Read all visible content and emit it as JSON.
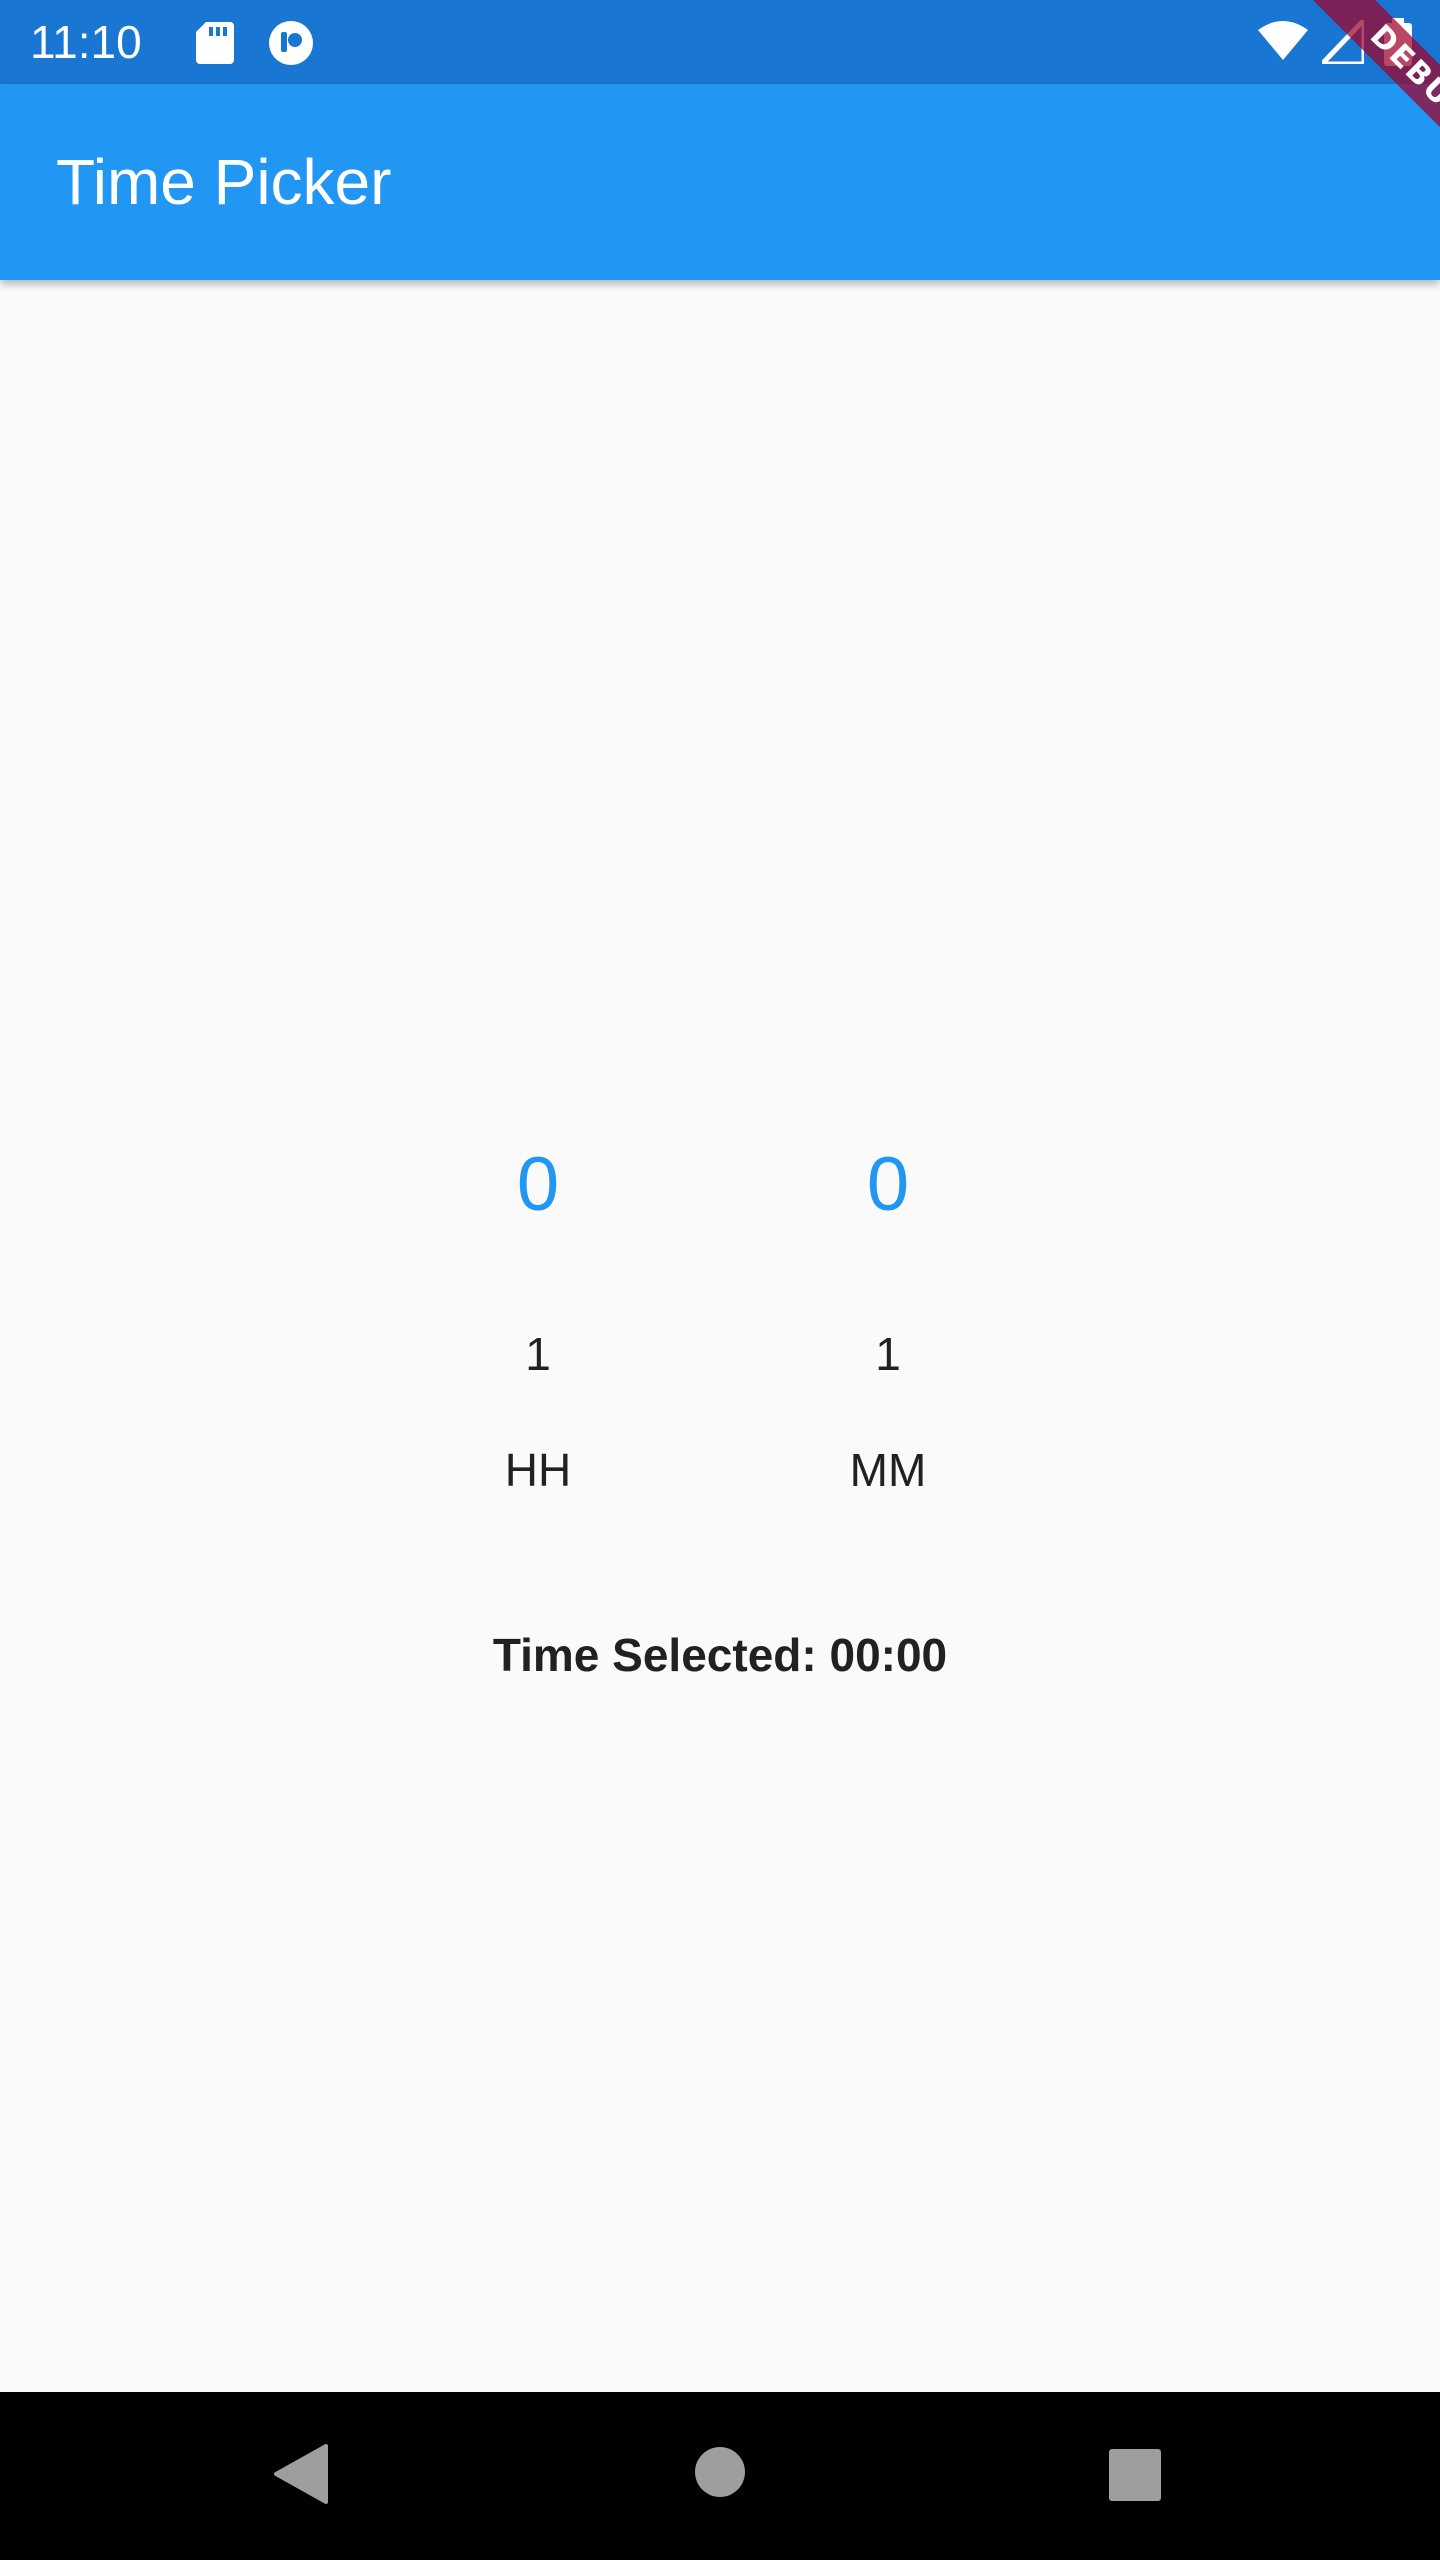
{
  "status_bar": {
    "time": "11:10",
    "icons": [
      "sd-card-icon",
      "app-notification-icon",
      "wifi-icon",
      "signal-icon",
      "battery-icon"
    ]
  },
  "app_bar": {
    "title": "Time Picker"
  },
  "debug_banner": {
    "label": "DEBUG"
  },
  "picker": {
    "hours": {
      "selected": "0",
      "next": "1",
      "label": "HH"
    },
    "minutes": {
      "selected": "0",
      "next": "1",
      "label": "MM"
    }
  },
  "result": {
    "prefix": "Time Selected: ",
    "value": "00:00"
  },
  "nav_bar": {
    "buttons": [
      "back-icon",
      "home-icon",
      "recents-icon"
    ]
  },
  "colors": {
    "status_bar": "#1976d2",
    "app_bar": "#2196f3",
    "accent": "#2196f3",
    "background": "#fafafa",
    "nav_bar": "#000000"
  }
}
